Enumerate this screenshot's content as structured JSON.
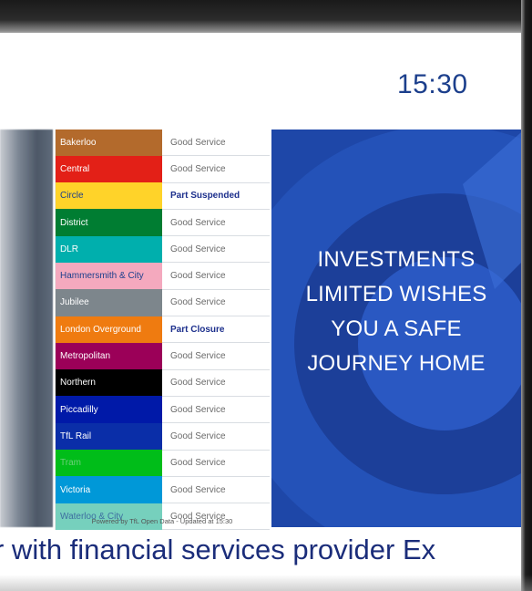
{
  "clock": {
    "time": "15:30"
  },
  "status_board": {
    "lines": [
      {
        "name": "Bakerloo",
        "status": "Good Service",
        "color": "#b36a2c",
        "text_color": "#ffffff",
        "alert": false
      },
      {
        "name": "Central",
        "status": "Good Service",
        "color": "#e32017",
        "text_color": "#ffffff",
        "alert": false
      },
      {
        "name": "Circle",
        "status": "Part Suspended",
        "color": "#ffd329",
        "text_color": "#1c3f8c",
        "alert": true
      },
      {
        "name": "District",
        "status": "Good Service",
        "color": "#007d32",
        "text_color": "#ffffff",
        "alert": false
      },
      {
        "name": "DLR",
        "status": "Good Service",
        "color": "#00afad",
        "text_color": "#ffffff",
        "alert": false
      },
      {
        "name": "Hammersmith & City",
        "status": "Good Service",
        "color": "#f4a9be",
        "text_color": "#1c3f8c",
        "alert": false
      },
      {
        "name": "Jubilee",
        "status": "Good Service",
        "color": "#7d868c",
        "text_color": "#ffffff",
        "alert": false
      },
      {
        "name": "London Overground",
        "status": "Part Closure",
        "color": "#ef7b10",
        "text_color": "#ffffff",
        "alert": true
      },
      {
        "name": "Metropolitan",
        "status": "Good Service",
        "color": "#9b0058",
        "text_color": "#ffffff",
        "alert": false
      },
      {
        "name": "Northern",
        "status": "Good Service",
        "color": "#000000",
        "text_color": "#ffffff",
        "alert": false
      },
      {
        "name": "Piccadilly",
        "status": "Good Service",
        "color": "#0019a8",
        "text_color": "#ffffff",
        "alert": false
      },
      {
        "name": "TfL Rail",
        "status": "Good Service",
        "color": "#0a2ea8",
        "text_color": "#ffffff",
        "alert": false
      },
      {
        "name": "Tram",
        "status": "Good Service",
        "color": "#00bd19",
        "text_color": "#6ccf7a",
        "alert": false
      },
      {
        "name": "Victoria",
        "status": "Good Service",
        "color": "#0098d8",
        "text_color": "#ffffff",
        "alert": false
      },
      {
        "name": "Waterloo & City",
        "status": "Good Service",
        "color": "#76d0bd",
        "text_color": "#3d6fa0",
        "alert": false
      }
    ],
    "footer": "Powered by TfL Open Data - Updated at 15:30"
  },
  "advert": {
    "lines": [
      "INVESTMENTS",
      "LIMITED WISHES",
      "YOU A SAFE",
      "JOURNEY HOME"
    ],
    "background_color": "#1e47a8"
  },
  "ticker": {
    "text": "r with financial services provider Ex"
  }
}
